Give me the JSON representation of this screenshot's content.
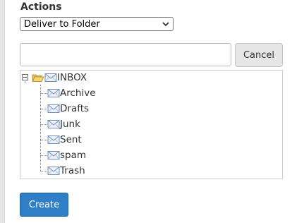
{
  "actions": {
    "label": "Actions",
    "selected_option": "Deliver to Folder"
  },
  "folder_input": {
    "value": "",
    "placeholder": ""
  },
  "buttons": {
    "cancel_label": "Cancel",
    "create_label": "Create"
  },
  "tree": {
    "root": {
      "label": "INBOX",
      "icon": "envelope-icon",
      "folder_icon": "open-folder-icon",
      "expander": "collapse-minus-icon"
    },
    "children": [
      {
        "label": "Archive",
        "icon": "envelope-icon"
      },
      {
        "label": "Drafts",
        "icon": "envelope-icon"
      },
      {
        "label": "Junk",
        "icon": "envelope-icon"
      },
      {
        "label": "Sent",
        "icon": "envelope-icon"
      },
      {
        "label": "spam",
        "icon": "envelope-icon"
      },
      {
        "label": "Trash",
        "icon": "envelope-icon"
      }
    ]
  },
  "colors": {
    "primary_button": "#2f7ec8",
    "secondary_button": "#e6e6e6"
  }
}
